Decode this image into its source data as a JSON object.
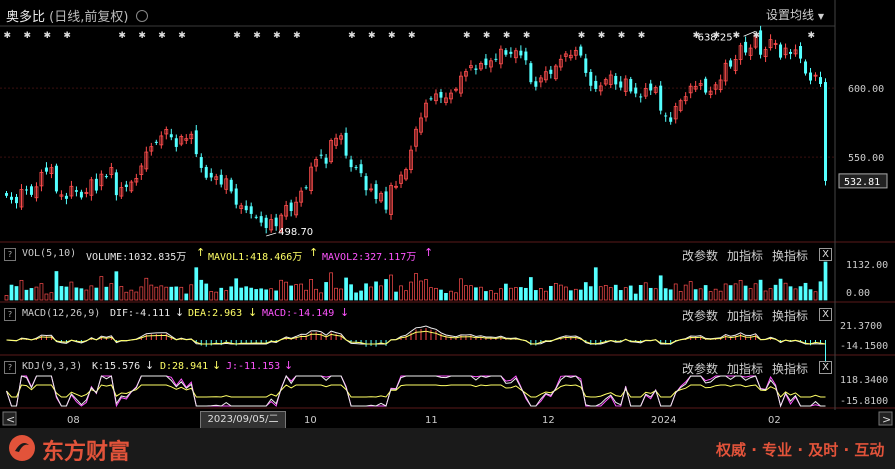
{
  "header": {
    "title": "奥多比",
    "subtitle": "(日线,前复权)",
    "settings_label": "设置均线"
  },
  "chart_data": [
    {
      "type": "candlestick",
      "title": "奥多比 (日线,前复权)",
      "ylim": [
        490,
        645
      ],
      "y_ticks": [
        "600.00",
        "550.00"
      ],
      "last_price_label": "532.81",
      "annotations": {
        "high": "638.25",
        "low": "498.70"
      },
      "x_labels": [
        "08",
        "09",
        "10",
        "11",
        "12",
        "2024",
        "02"
      ],
      "close_prices": [
        522.0,
        519.1,
        516.7,
        526.6,
        526.1,
        522.7,
        528.5,
        539.0,
        539.5,
        542.4,
        525.2,
        522.7,
        519.8,
        528.9,
        524.9,
        520.8,
        524.5,
        533.6,
        525.8,
        537.7,
        536.0,
        542.5,
        522.5,
        528.0,
        528.4,
        532.0,
        534.6,
        543.6,
        553.7,
        557.6,
        560.3,
        565.4,
        570.1,
        564.4,
        557.4,
        565.0,
        563.4,
        566.6,
        552.2,
        542.2,
        535.1,
        535.3,
        535.8,
        530.2,
        534.3,
        525.2,
        515.6,
        514.8,
        511.6,
        508.9,
        506.6,
        502.6,
        498.7,
        504.8,
        500.0,
        508.0,
        515.0,
        511.0,
        517.4,
        525.4,
        527.9,
        542.8,
        548.3,
        551.0,
        545.3,
        562.1,
        563.7,
        565.5,
        551.1,
        542.8,
        542.1,
        538.4,
        526.1,
        527.0,
        519.7,
        523.8,
        512.0,
        529.5,
        528.9,
        537.0,
        541.0,
        555.1,
        570.2,
        578.4,
        589.1,
        592.3,
        595.8,
        593.1,
        592.9,
        596.4,
        599.2,
        608.7,
        612.0,
        616.3,
        613.2,
        617.9,
        616.7,
        619.8,
        621.1,
        628.2,
        624.2,
        624.8,
        627.1,
        623.7,
        620.2,
        604.3,
        601.0,
        607.4,
        611.9,
        610.3,
        616.0,
        620.9,
        624.8,
        623.8,
        627.3,
        623.6,
        611.0,
        601.7,
        599.4,
        601.6,
        606.2,
        609.5,
        602.7,
        600.4,
        606.6,
        597.6,
        596.1,
        593.5,
        599.8,
        598.3,
        600.4,
        583.7,
        579.5,
        575.6,
        586.7,
        590.9,
        593.8,
        601.4,
        601.3,
        603.3,
        596.8,
        597.8,
        602.4,
        605.9,
        618.0,
        615.6,
        620.8,
        630.7,
        625.8,
        629.0,
        638.3,
        624.2,
        627.9,
        635.1,
        632.3,
        622.1,
        629.0,
        624.8,
        627.7,
        621.4,
        610.6,
        605.5,
        609.4,
        603.0,
        532.8
      ]
    },
    {
      "type": "bar",
      "title": "VOL(5,10)",
      "values_text": [
        "VOLUME:1032.835万",
        "MAVOL1:418.466万",
        "MAVOL2:327.117万"
      ],
      "y_ticks": [
        "1132.00",
        "0.00"
      ],
      "ylim": [
        0,
        1132
      ]
    },
    {
      "type": "line",
      "title": "MACD(12,26,9)",
      "values_text": [
        "DIF:-4.111",
        "DEA:2.963",
        "MACD:-14.149"
      ],
      "y_ticks": [
        "21.3700",
        "-14.1500"
      ]
    },
    {
      "type": "line",
      "title": "KDJ(9,3,3)",
      "values_text": [
        "K:15.576",
        "D:28.941",
        "J:-11.153"
      ],
      "y_ticks": [
        "118.3400",
        "-15.8100"
      ]
    }
  ],
  "toolbar": {
    "params": "改参数",
    "add": "加指标",
    "switch": "换指标",
    "close": "X",
    "help": "?"
  },
  "nav": {
    "date_tip": "2023/09/05/二",
    "left": "<",
    "right": ">"
  },
  "footer": {
    "brand": "东方财富",
    "slogan": "权威 · 专业 · 及时 · 互动"
  },
  "colors": {
    "up": "#ff4d4d",
    "down": "#54ffff",
    "ma1": "#ffff66",
    "ma2": "#ff55ff",
    "brand": "#e2533a"
  }
}
